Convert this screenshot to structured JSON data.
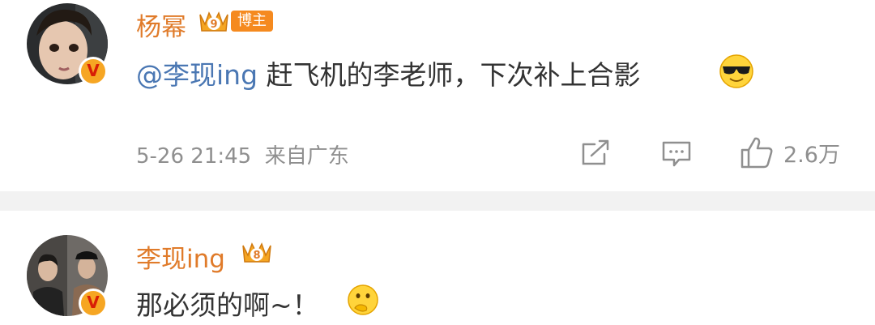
{
  "comments": [
    {
      "username": "杨幂",
      "badge": "博主",
      "mention": "@李现ing",
      "text": " 赶飞机的李老师，下次补上合影",
      "time": "5-26 21:45",
      "location": "来自广东",
      "likes": "2.6万",
      "verified_mark": "V",
      "crown_level": "9"
    },
    {
      "username": "李现ing",
      "text": "那必须的啊~！",
      "verified_mark": "V",
      "crown_level": "8"
    }
  ],
  "colors": {
    "username": "#e07b2a",
    "mention": "#4a77b3",
    "text": "#333333",
    "meta": "#8f8f8f",
    "divider": "#f2f2f2"
  }
}
